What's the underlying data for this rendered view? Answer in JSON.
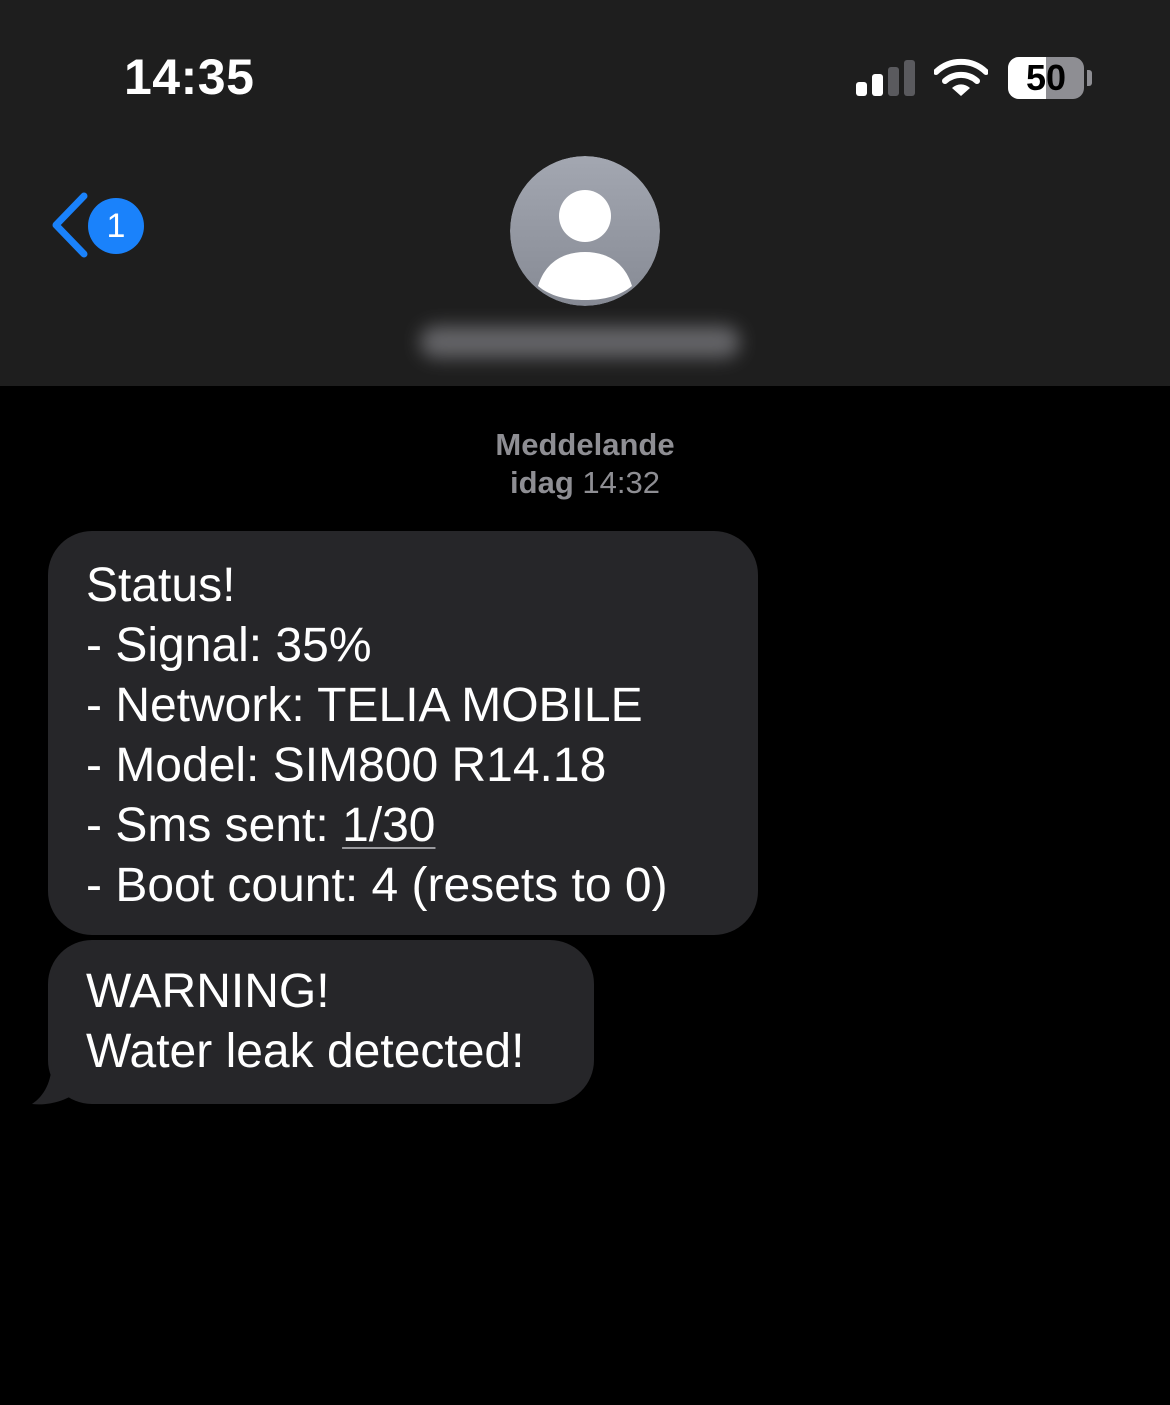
{
  "status_bar": {
    "time": "14:35",
    "cellular_bars_active": 2,
    "cellular_bars_total": 4,
    "wifi": "wifi-icon",
    "battery_percent": 50,
    "battery_label": "50"
  },
  "header": {
    "back_unread_count": "1",
    "back_icon": "chevron-left-icon",
    "avatar_icon": "person-icon",
    "contact_name_blurred": true
  },
  "conversation": {
    "service_label": "Meddelande",
    "timestamp_day": "idag",
    "timestamp_time": "14:32"
  },
  "messages": [
    {
      "direction": "incoming",
      "lines": {
        "l1": "Status!",
        "l2": "- Signal: 35%",
        "l3": "- Network: TELIA MOBILE",
        "l4": "- Model: SIM800 R14.18",
        "l5_prefix": "- Sms sent: ",
        "l5_link": "1/30",
        "l6": "- Boot count: 4 (resets to 0)"
      }
    },
    {
      "direction": "incoming",
      "lines": {
        "l1": "WARNING!",
        "l2": "Water leak detected!"
      }
    }
  ],
  "colors": {
    "header_bg": "#1e1e1e",
    "screen_bg": "#000000",
    "bubble_bg": "#262629",
    "accent_blue": "#1a82fb",
    "meta_gray": "#8e8e93"
  }
}
